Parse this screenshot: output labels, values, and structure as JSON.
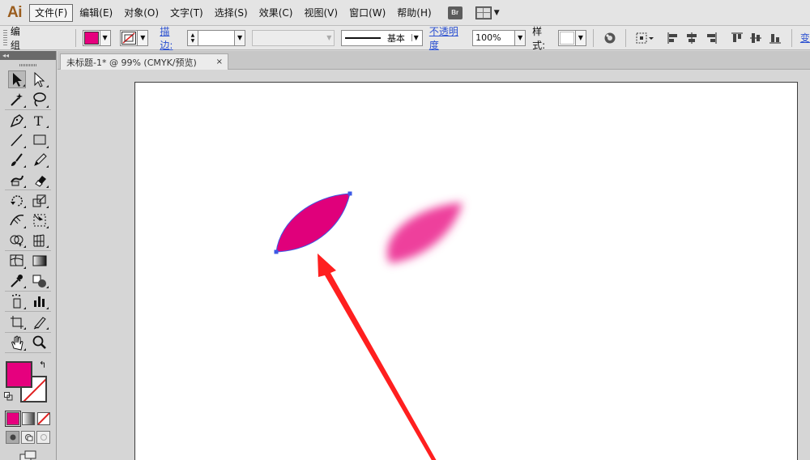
{
  "app": {
    "logo": "Ai"
  },
  "menu": [
    {
      "label": "文件(F)",
      "active": true
    },
    {
      "label": "编辑(E)"
    },
    {
      "label": "对象(O)"
    },
    {
      "label": "文字(T)"
    },
    {
      "label": "选择(S)"
    },
    {
      "label": "效果(C)"
    },
    {
      "label": "视图(V)"
    },
    {
      "label": "窗口(W)"
    },
    {
      "label": "帮助(H)"
    }
  ],
  "menubar_icons": {
    "bridge": "Br",
    "workspace_icon": "workspace-switcher-icon"
  },
  "control": {
    "selection_label": "编组",
    "fill_color": "#e6007e",
    "stroke_color": "none",
    "stroke_label": "描边:",
    "stroke_weight": "",
    "stroke_profile": "基本",
    "opacity_label": "不透明度",
    "opacity_value": "100%",
    "style_label": "样式:",
    "overflow_label": "变"
  },
  "document": {
    "tab_title": "未标题-1* @ 99% (CMYK/预览)",
    "close": "×"
  },
  "toolbox": {
    "header": "◂◂",
    "tools": [
      [
        "selection-tool",
        "direct-selection-tool"
      ],
      [
        "magic-wand-tool",
        "lasso-tool"
      ],
      [
        "pen-tool",
        "type-tool"
      ],
      [
        "line-segment-tool",
        "rectangle-tool"
      ],
      [
        "paintbrush-tool",
        "pencil-tool"
      ],
      [
        "blob-brush-tool",
        "eraser-tool"
      ],
      [
        "rotate-tool",
        "scale-tool"
      ],
      [
        "width-tool",
        "free-transform-tool"
      ],
      [
        "shape-builder-tool",
        "perspective-grid-tool"
      ],
      [
        "mesh-tool",
        "gradient-tool"
      ],
      [
        "eyedropper-tool",
        "blend-tool"
      ],
      [
        "symbol-sprayer-tool",
        "column-graph-tool"
      ],
      [
        "artboard-tool",
        "slice-tool"
      ],
      [
        "hand-tool",
        "zoom-tool"
      ]
    ],
    "type_tool_glyph": "T",
    "fill_color": "#e6007e"
  },
  "colors": {
    "petal_solid": "#e0007b",
    "petal_blur": "#ee3f9c",
    "selection_outline": "#3d5ae6",
    "arrow": "#ff1f1f"
  }
}
